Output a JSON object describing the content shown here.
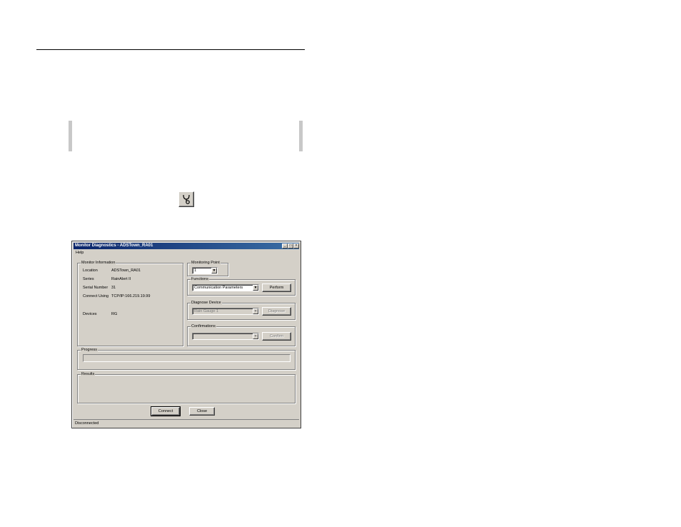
{
  "window": {
    "title": "Monitor Diagnostics - ADSTown_RA01",
    "menu": [
      "Help"
    ]
  },
  "monitor_information": {
    "label": "Monitor Information",
    "fields": [
      {
        "name": "Location",
        "value": "ADSTown_RA01"
      },
      {
        "name": "Series",
        "value": "RainAlert II"
      },
      {
        "name": "Serial Number",
        "value": "31"
      },
      {
        "name": "Connect Using",
        "value": "TCP/IP:166.219.19.99"
      },
      {
        "name": "Devices",
        "value": "RG"
      }
    ]
  },
  "monitoring_point": {
    "label": "Monitoring Point",
    "value": "1"
  },
  "functions": {
    "label": "Functions",
    "value": "Communication Parameters",
    "button": "Perform"
  },
  "diagnose_device": {
    "label": "Diagnose Device",
    "value": "Rain Gauge 1",
    "button": "Diagnose"
  },
  "confirmations": {
    "label": "Confirmations",
    "value": "",
    "button": "Confirm"
  },
  "progress": {
    "label": "Progress",
    "value": 0
  },
  "results": {
    "label": "Results"
  },
  "buttons": {
    "connect": "Connect",
    "close": "Close"
  },
  "status": "Disconnected"
}
